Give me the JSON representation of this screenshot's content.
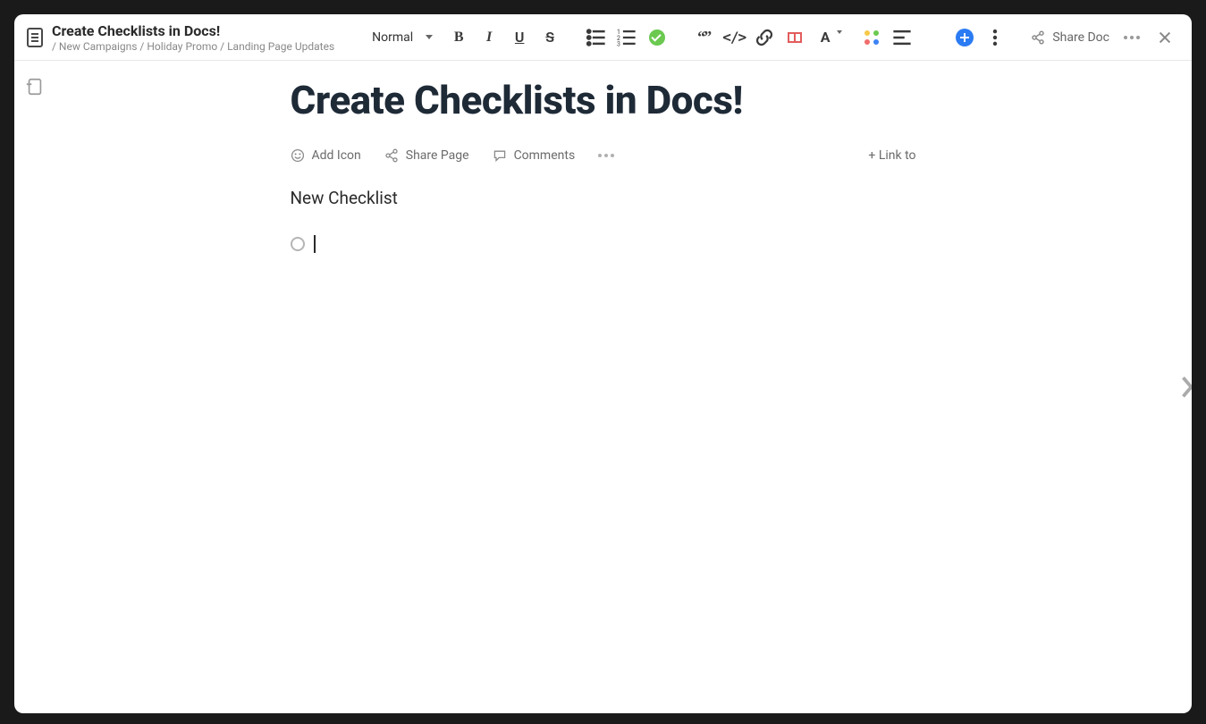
{
  "header": {
    "title": "Create Checklists in Docs!",
    "breadcrumb": "/ New Campaigns / Holiday Promo / Landing Page Updates",
    "textStyle": "Normal",
    "shareDoc": "Share Doc"
  },
  "page": {
    "title": "Create Checklists in Docs!",
    "actions": {
      "addIcon": "Add Icon",
      "sharePage": "Share Page",
      "comments": "Comments",
      "linkTo": "+ Link to"
    },
    "sectionHeading": "New Checklist",
    "checklist": [
      {
        "checked": false,
        "text": ""
      }
    ]
  },
  "toolbar": {
    "icons": {
      "bold": "B",
      "italic": "I",
      "underline": "U",
      "strike": "S",
      "quote": "“”",
      "code": "</>",
      "link": "link",
      "font": "A"
    }
  }
}
